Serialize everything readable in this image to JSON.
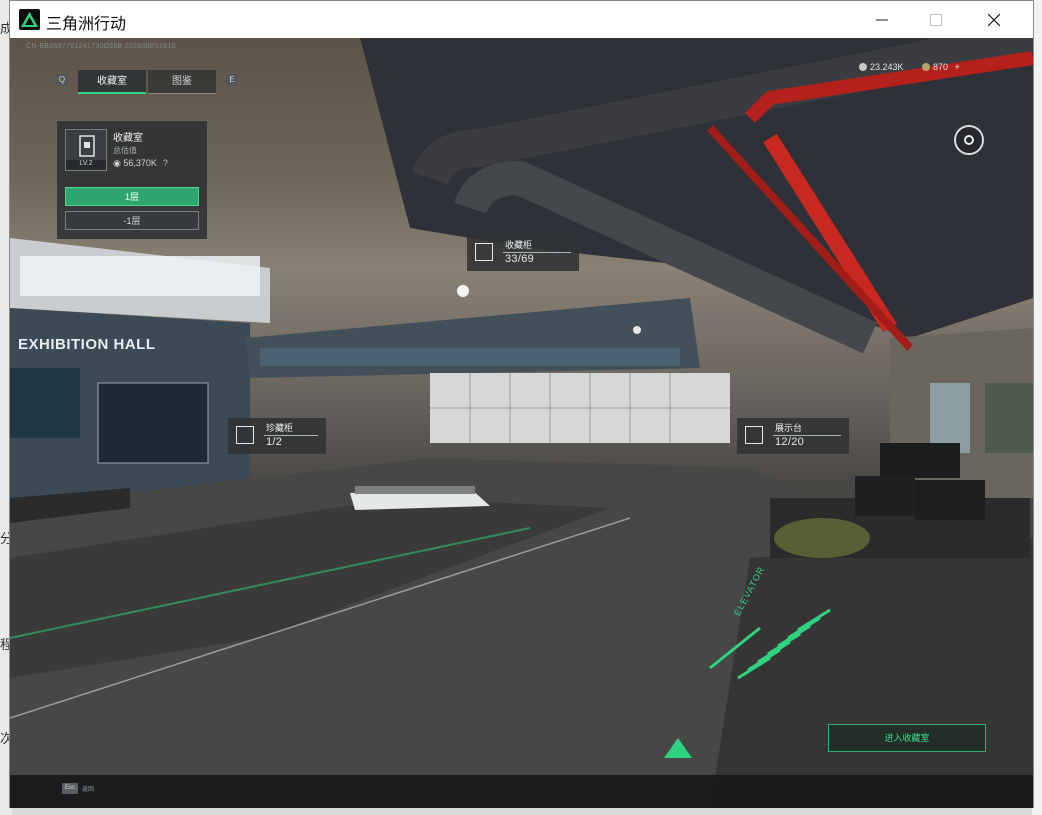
{
  "window": {
    "title": "三角洲行动"
  },
  "desktop": {
    "left_labels": [
      "成",
      "分",
      "程",
      "次"
    ]
  },
  "hud": {
    "session_id": "CN-BB3697761241730D55B 2026080S1610",
    "tabs": [
      {
        "label": "收藏室",
        "active": true
      },
      {
        "label": "图鉴",
        "active": false
      }
    ],
    "tab_prev_key": "Q",
    "tab_next_key": "E",
    "currency_1": "23.243K",
    "currency_2": "870",
    "currency_plus": "+",
    "accent_color": "#2fd37f"
  },
  "room_panel": {
    "name": "收藏室",
    "subtitle": "总估值",
    "value": "56,370K",
    "help": "?",
    "level": "LV.2",
    "floors": [
      "1层",
      "-1层"
    ]
  },
  "markers": {
    "cabinet": {
      "name": "收藏柜",
      "count": "33/69"
    },
    "treasure": {
      "name": "珍藏柜",
      "count": "1/2"
    },
    "display": {
      "name": "展示台",
      "count": "12/20"
    }
  },
  "scene": {
    "hall_sign": "EXHIBITION HALL",
    "floor_text": "ELEVATOR"
  },
  "actions": {
    "enter_label": "进入收藏室"
  },
  "footer": {
    "esc_key": "Esc",
    "esc_label": "返回"
  }
}
